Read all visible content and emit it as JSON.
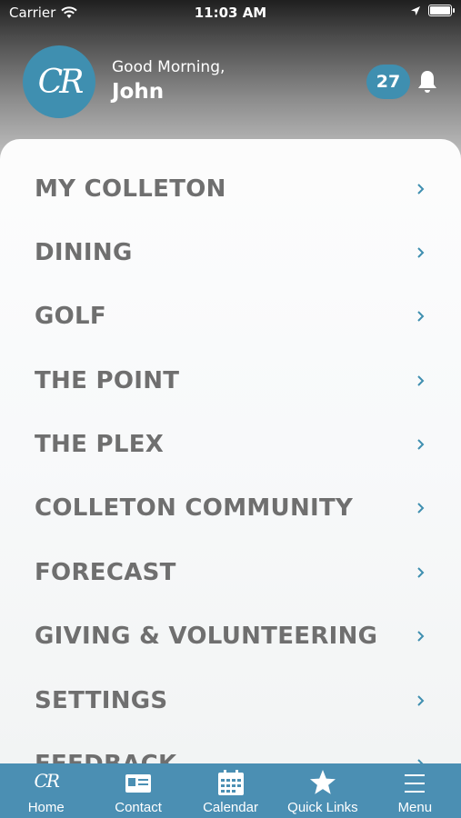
{
  "status_bar": {
    "carrier": "Carrier",
    "time": "11:03 AM"
  },
  "header": {
    "avatar_initials": "CR",
    "greeting": "Good Morning,",
    "user_name": "John",
    "notification_count": "27"
  },
  "menu": {
    "items": [
      {
        "label": "MY COLLETON"
      },
      {
        "label": "DINING"
      },
      {
        "label": "GOLF"
      },
      {
        "label": "THE POINT"
      },
      {
        "label": "THE PLEX"
      },
      {
        "label": "COLLETON COMMUNITY"
      },
      {
        "label": "FORECAST"
      },
      {
        "label": "GIVING & VOLUNTEERING"
      },
      {
        "label": "SETTINGS"
      },
      {
        "label": "FEEDBACK"
      }
    ]
  },
  "tab_bar": {
    "tabs": [
      {
        "label": "Home",
        "icon": "cr-logo-icon"
      },
      {
        "label": "Contact",
        "icon": "contact-card-icon"
      },
      {
        "label": "Calendar",
        "icon": "calendar-icon"
      },
      {
        "label": "Quick Links",
        "icon": "star-icon"
      },
      {
        "label": "Menu",
        "icon": "hamburger-menu-icon"
      }
    ]
  },
  "colors": {
    "accent": "#4b8fb3",
    "menu_text": "#6f6f6f"
  }
}
